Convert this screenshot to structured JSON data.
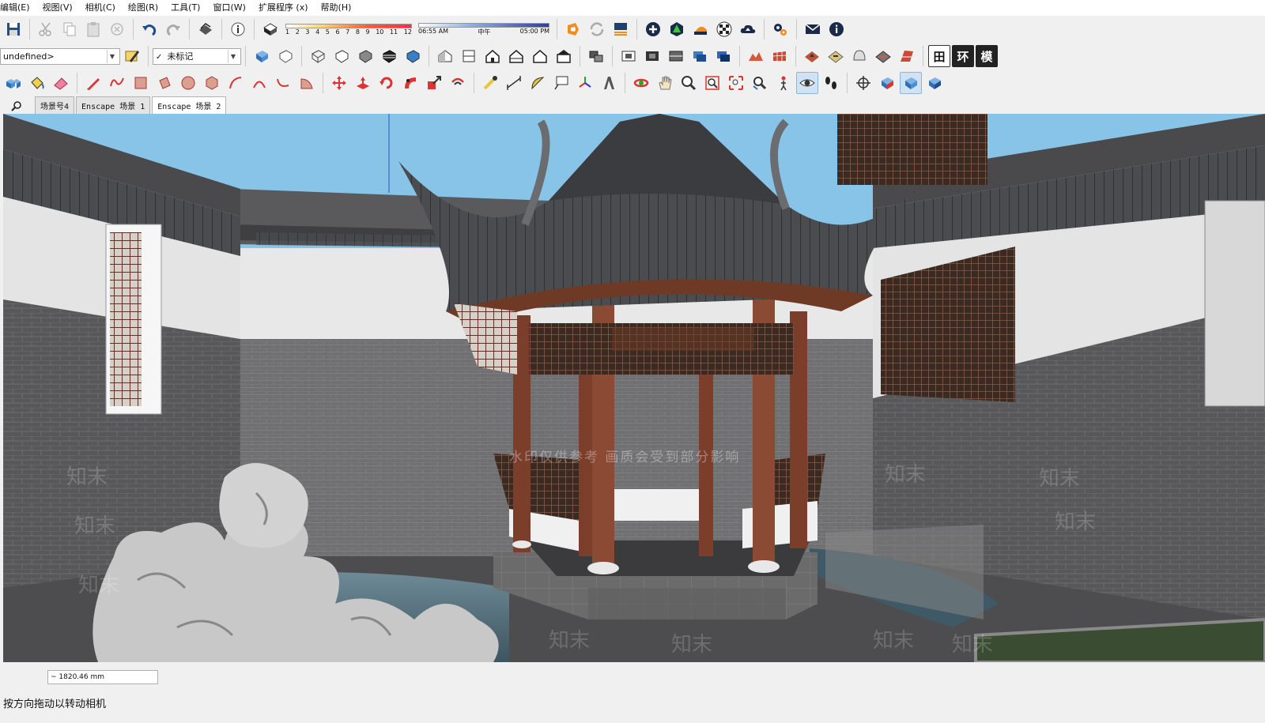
{
  "menubar": {
    "items": [
      "编辑(E)",
      "视图(V)",
      "相机(C)",
      "绘图(R)",
      "工具(T)",
      "窗口(W)",
      "扩展程序 (x)",
      "帮助(H)"
    ]
  },
  "shadow": {
    "month_ticks": [
      "1",
      "2",
      "3",
      "4",
      "5",
      "6",
      "7",
      "8",
      "9",
      "10",
      "11",
      "12"
    ],
    "time_start": "06:55 AM",
    "time_noon": "中午",
    "time_end": "05:00 PM"
  },
  "style_combo": {
    "value": "undefined>"
  },
  "tag_combo": {
    "value": "未标记"
  },
  "toolbar_text_buttons": [
    "田",
    "环",
    "模"
  ],
  "scene_tabs": [
    "场景号4",
    "Enscape 场景 1",
    "Enscape 场景 2"
  ],
  "selected_scene": 2,
  "viewport": {
    "watermark": "水印仅供参考  画质会受到部分影响",
    "watermark_marks": [
      "知末",
      "知末",
      "知末",
      "知末",
      "知末",
      "知末",
      "知末",
      "知末",
      "知末",
      "知末"
    ]
  },
  "measurements": {
    "value": "~ 1820.46 mm"
  },
  "status": {
    "text": "按方向拖动以转动相机"
  },
  "colors": {
    "sky": "#88c4e8",
    "brick": "#58585a",
    "timber": "#7a3e2b",
    "roof": "#4a4c4f",
    "plaster": "#e8e8e8"
  }
}
